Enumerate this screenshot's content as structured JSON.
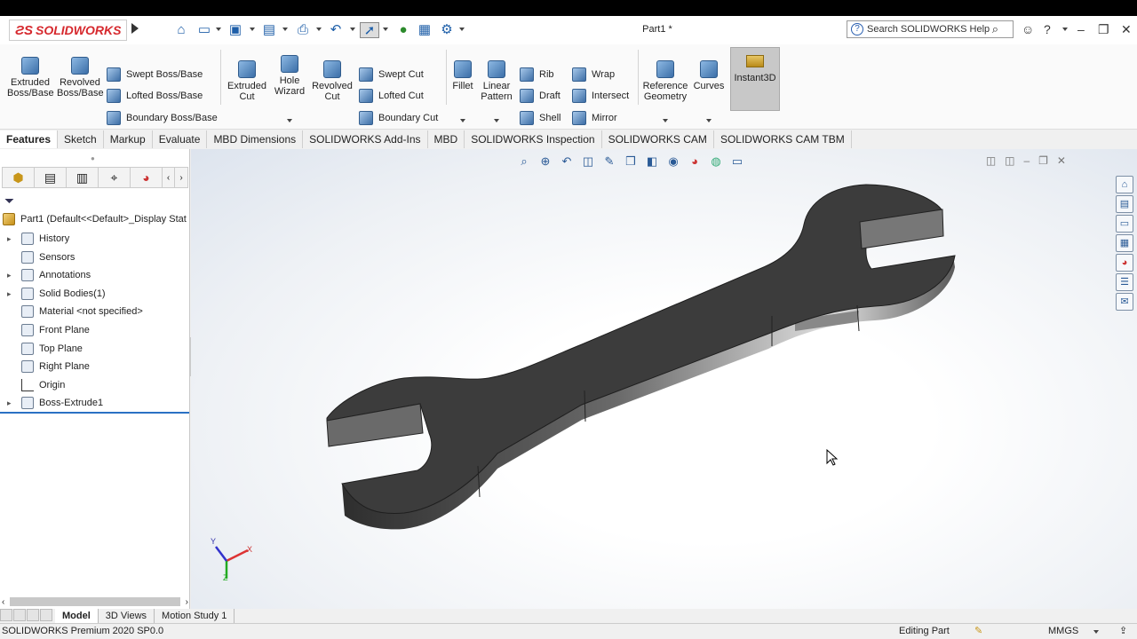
{
  "app": {
    "name": "SOLIDWORKS",
    "doc_title": "Part1 *",
    "search_placeholder": "Search SOLIDWORKS Help"
  },
  "command_manager": {
    "extruded_boss": "Extruded Boss/Base",
    "revolved_boss": "Revolved Boss/Base",
    "swept_boss": "Swept Boss/Base",
    "lofted_boss": "Lofted Boss/Base",
    "boundary_boss": "Boundary Boss/Base",
    "extruded_cut": "Extruded Cut",
    "hole_wizard": "Hole Wizard",
    "revolved_cut": "Revolved Cut",
    "swept_cut": "Swept Cut",
    "lofted_cut": "Lofted Cut",
    "boundary_cut": "Boundary Cut",
    "fillet": "Fillet",
    "linear_pattern": "Linear Pattern",
    "rib": "Rib",
    "draft": "Draft",
    "shell": "Shell",
    "wrap": "Wrap",
    "intersect": "Intersect",
    "mirror": "Mirror",
    "reference_geometry": "Reference Geometry",
    "curves": "Curves",
    "instant3d": "Instant3D"
  },
  "tabs": [
    "Features",
    "Sketch",
    "Markup",
    "Evaluate",
    "MBD Dimensions",
    "SOLIDWORKS Add-Ins",
    "MBD",
    "SOLIDWORKS Inspection",
    "SOLIDWORKS CAM",
    "SOLIDWORKS CAM TBM"
  ],
  "feature_tree": {
    "root": "Part1  (Default<<Default>_Display Stat",
    "items": [
      {
        "label": "History",
        "expandable": true
      },
      {
        "label": "Sensors",
        "expandable": false
      },
      {
        "label": "Annotations",
        "expandable": true
      },
      {
        "label": "Solid Bodies(1)",
        "expandable": true
      },
      {
        "label": "Material <not specified>",
        "expandable": false
      },
      {
        "label": "Front Plane",
        "expandable": false
      },
      {
        "label": "Top Plane",
        "expandable": false
      },
      {
        "label": "Right Plane",
        "expandable": false
      },
      {
        "label": "Origin",
        "expandable": false
      },
      {
        "label": "Boss-Extrude1",
        "expandable": true
      }
    ]
  },
  "bottom_tabs": [
    "Model",
    "3D Views",
    "Motion Study 1"
  ],
  "status": {
    "version": "SOLIDWORKS Premium 2020 SP0.0",
    "mode": "Editing Part",
    "units": "MMGS"
  },
  "triad": {
    "x": "X",
    "y": "Y",
    "z": "Z"
  }
}
